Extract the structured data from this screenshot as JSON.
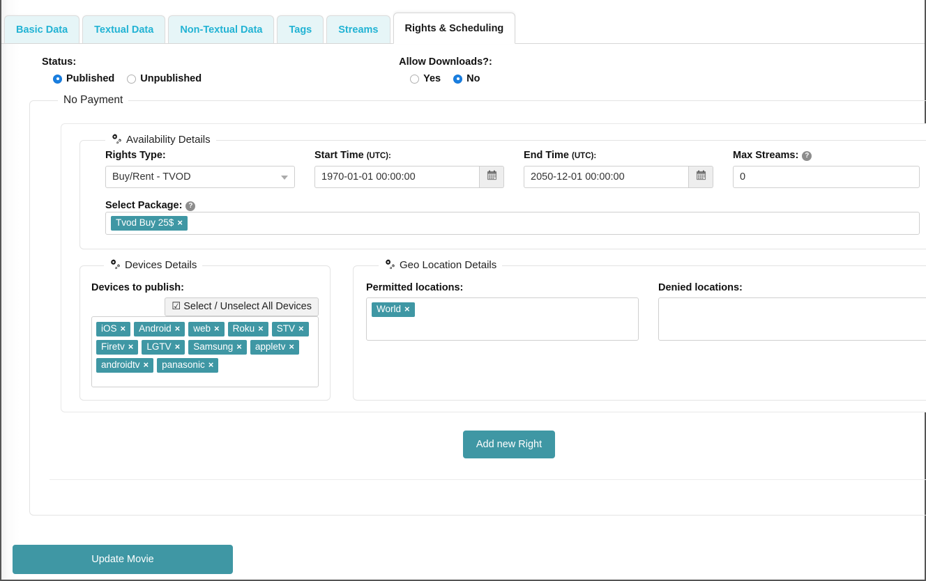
{
  "tabs": [
    {
      "label": "Basic Data",
      "active": false
    },
    {
      "label": "Textual Data",
      "active": false
    },
    {
      "label": "Non-Textual Data",
      "active": false
    },
    {
      "label": "Tags",
      "active": false
    },
    {
      "label": "Streams",
      "active": false
    },
    {
      "label": "Rights & Scheduling",
      "active": true
    }
  ],
  "status": {
    "label": "Status:",
    "options": [
      {
        "label": "Published",
        "selected": true
      },
      {
        "label": "Unpublished",
        "selected": false
      }
    ]
  },
  "downloads": {
    "label": "Allow Downloads?:",
    "options": [
      {
        "label": "Yes",
        "selected": false
      },
      {
        "label": "No",
        "selected": true
      }
    ]
  },
  "payment_fieldset": {
    "legend": "No Payment"
  },
  "availability": {
    "legend": "Availability Details",
    "icon": "cogs-icon",
    "rights_type": {
      "label": "Rights Type:",
      "value": "Buy/Rent - TVOD",
      "caret_icon": "chevron-down-icon"
    },
    "start_time": {
      "label": "Start Time",
      "sublabel": "(UTC):",
      "value": "1970-01-01 00:00:00",
      "icon": "calendar-icon"
    },
    "end_time": {
      "label": "End Time",
      "sublabel": "(UTC):",
      "value": "2050-12-01 00:00:00",
      "icon": "calendar-icon"
    },
    "max_streams": {
      "label": "Max Streams:",
      "value": "0",
      "help_icon": "question-circle-icon",
      "help_glyph": "?"
    },
    "select_package": {
      "label": "Select Package:",
      "help_icon": "question-circle-icon",
      "help_glyph": "?",
      "tags": [
        {
          "label": "Tvod Buy 25$",
          "remove": "×"
        }
      ]
    }
  },
  "devices": {
    "legend": "Devices Details",
    "icon": "cogs-icon",
    "label": "Devices to publish:",
    "select_all": {
      "label": "Select / Unselect All Devices",
      "icon": "checkbox-checked-icon",
      "glyph": "☑"
    },
    "tags": [
      {
        "label": "iOS",
        "remove": "×"
      },
      {
        "label": "Android",
        "remove": "×"
      },
      {
        "label": "web",
        "remove": "×"
      },
      {
        "label": "Roku",
        "remove": "×"
      },
      {
        "label": "STV",
        "remove": "×"
      },
      {
        "label": "Firetv",
        "remove": "×"
      },
      {
        "label": "LGTV",
        "remove": "×"
      },
      {
        "label": "Samsung",
        "remove": "×"
      },
      {
        "label": "appletv",
        "remove": "×"
      },
      {
        "label": "androidtv",
        "remove": "×"
      },
      {
        "label": "panasonic",
        "remove": "×"
      }
    ]
  },
  "geo": {
    "legend": "Geo Location Details",
    "icon": "cogs-icon",
    "permitted": {
      "label": "Permitted locations:",
      "tags": [
        {
          "label": "World",
          "remove": "×"
        }
      ]
    },
    "denied": {
      "label": "Denied locations:",
      "tags": []
    }
  },
  "actions": {
    "add_right": "Add new Right",
    "update_movie": "Update Movie"
  },
  "colors": {
    "teal": "#3f97a4",
    "tab_text": "#22b3d4",
    "tab_bg": "#e6f5f7",
    "radio_blue": "#1a7fe0"
  }
}
